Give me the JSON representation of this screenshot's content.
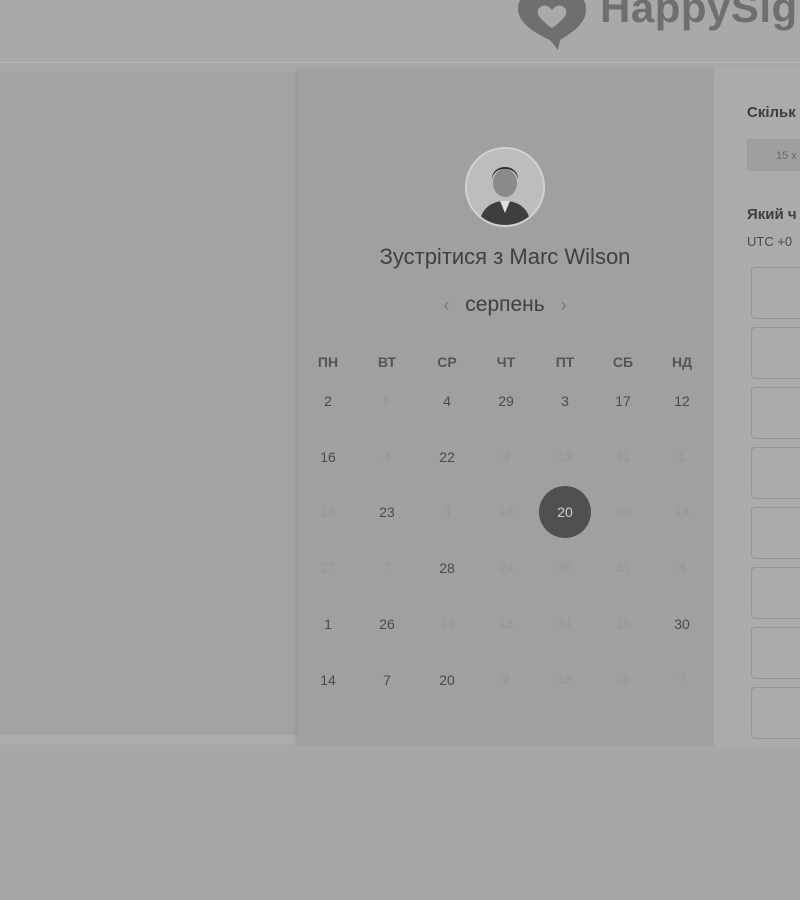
{
  "brand": {
    "name": "HappySig",
    "logo_icon": "speech-bubble-heart-icon"
  },
  "calendar": {
    "title": "Зустрітися з Marc Wilson",
    "month": "серпень",
    "prev_icon": "chevron-left-icon",
    "next_icon": "chevron-right-icon",
    "weekdays": [
      "ПН",
      "ВТ",
      "СР",
      "ЧТ",
      "ПТ",
      "СБ",
      "НД"
    ],
    "weeks": [
      [
        {
          "d": "2",
          "m": false
        },
        {
          "d": "6",
          "m": true
        },
        {
          "d": "4",
          "m": false
        },
        {
          "d": "29",
          "m": false
        },
        {
          "d": "3",
          "m": false
        },
        {
          "d": "17",
          "m": false
        },
        {
          "d": "12",
          "m": false
        }
      ],
      [
        {
          "d": "16",
          "m": false
        },
        {
          "d": "4",
          "m": true
        },
        {
          "d": "22",
          "m": false
        },
        {
          "d": "3",
          "m": true
        },
        {
          "d": "13",
          "m": true
        },
        {
          "d": "31",
          "m": true
        },
        {
          "d": "1",
          "m": true
        }
      ],
      [
        {
          "d": "14",
          "m": true
        },
        {
          "d": "23",
          "m": false
        },
        {
          "d": "3",
          "m": true
        },
        {
          "d": "16",
          "m": true
        },
        {
          "d": "20",
          "m": false,
          "sel": true
        },
        {
          "d": "20",
          "m": true
        },
        {
          "d": "14",
          "m": true
        }
      ],
      [
        {
          "d": "27",
          "m": true
        },
        {
          "d": "7",
          "m": true
        },
        {
          "d": "28",
          "m": false
        },
        {
          "d": "24",
          "m": true
        },
        {
          "d": "25",
          "m": true
        },
        {
          "d": "31",
          "m": true
        },
        {
          "d": "4",
          "m": true
        }
      ],
      [
        {
          "d": "1",
          "m": false
        },
        {
          "d": "26",
          "m": false
        },
        {
          "d": "14",
          "m": true
        },
        {
          "d": "13",
          "m": true
        },
        {
          "d": "31",
          "m": true
        },
        {
          "d": "15",
          "m": true
        },
        {
          "d": "30",
          "m": false
        }
      ],
      [
        {
          "d": "14",
          "m": false
        },
        {
          "d": "7",
          "m": false
        },
        {
          "d": "20",
          "m": false
        },
        {
          "d": "9",
          "m": true
        },
        {
          "d": "18",
          "m": true
        },
        {
          "d": "29",
          "m": true
        },
        {
          "d": "7",
          "m": true
        }
      ]
    ]
  },
  "side": {
    "duration_label": "Скільк",
    "duration_value": "15 х",
    "time_label": "Який ч",
    "timezone": "UTC +0"
  },
  "colors": {
    "selected_day": "#505050"
  }
}
